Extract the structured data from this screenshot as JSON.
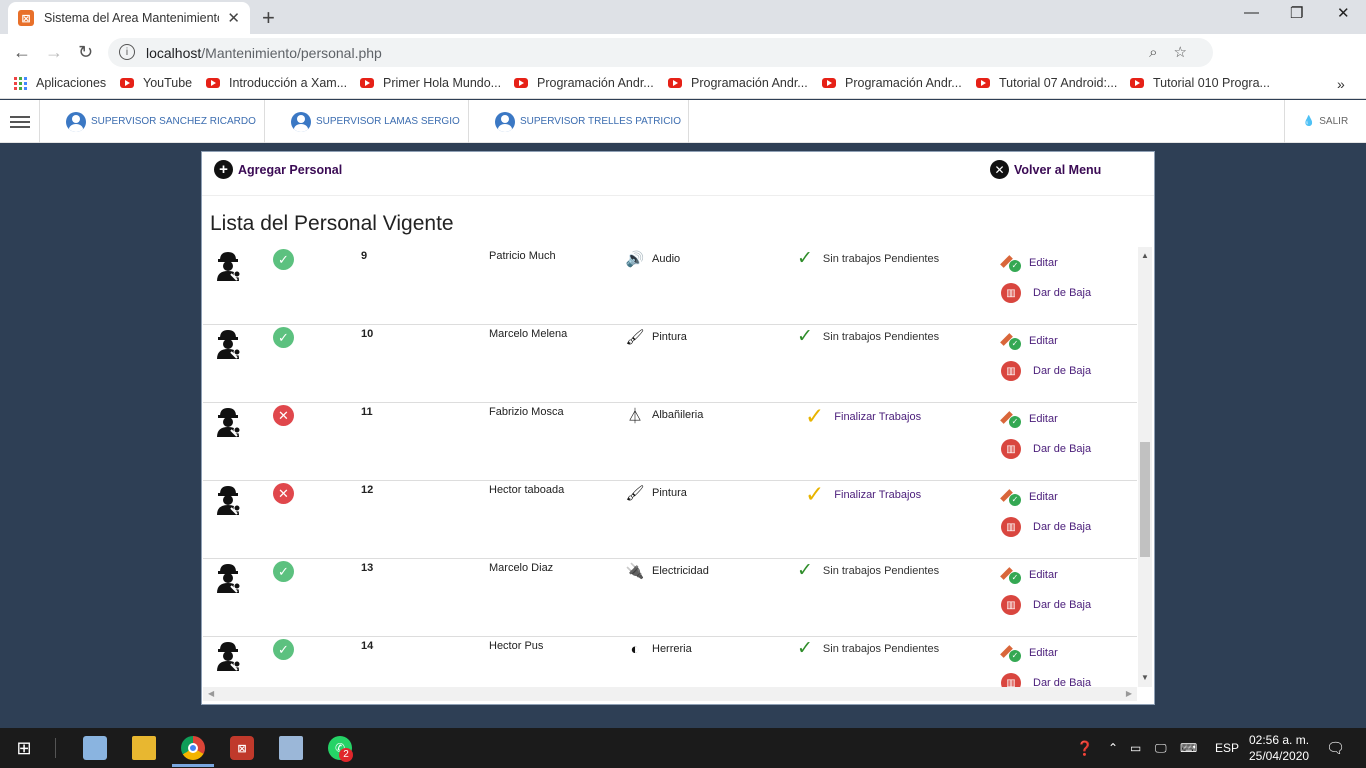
{
  "browser": {
    "tab_title": "Sistema del Area Mantenimiento",
    "url_host": "localhost",
    "url_path": "/Mantenimiento/personal.php"
  },
  "bookmarks": [
    {
      "label": "Aplicaciones",
      "icon": "apps-grid-icon"
    },
    {
      "label": "YouTube",
      "icon": "youtube-icon"
    },
    {
      "label": "Introducción a Xam...",
      "icon": "youtube-icon"
    },
    {
      "label": "Primer Hola Mundo...",
      "icon": "youtube-icon"
    },
    {
      "label": "Programación Andr...",
      "icon": "youtube-icon"
    },
    {
      "label": "Programación Andr...",
      "icon": "youtube-icon"
    },
    {
      "label": "Programación Andr...",
      "icon": "youtube-icon"
    },
    {
      "label": "Tutorial 07 Android:...",
      "icon": "youtube-icon"
    },
    {
      "label": "Tutorial 010 Progra...",
      "icon": "youtube-icon"
    }
  ],
  "nav": {
    "supervisors": [
      "SUPERVISOR SANCHEZ RICARDO",
      "SUPERVISOR LAMAS SERGIO",
      "SUPERVISOR TRELLES PATRICIO"
    ],
    "logout": "SALIR"
  },
  "panel": {
    "add_label": "Agregar Personal",
    "back_label": "Volver al Menu",
    "title": "Lista del Personal Vigente"
  },
  "rows": [
    {
      "status": "ok",
      "id": "9",
      "name": "Patricio Much",
      "specialty": "Audio",
      "specialty_icon": "speaker-icon",
      "work": "Sin trabajos Pendientes",
      "work_type": "done",
      "edit": "Editar",
      "remove": "Dar de Baja"
    },
    {
      "status": "ok",
      "id": "10",
      "name": "Marcelo Melena",
      "specialty": "Pintura",
      "specialty_icon": "paint-gun-icon",
      "work": "Sin trabajos Pendientes",
      "work_type": "done",
      "edit": "Editar",
      "remove": "Dar de Baja"
    },
    {
      "status": "bad",
      "id": "11",
      "name": "Fabrizio Mosca",
      "specialty": "Albañileria",
      "specialty_icon": "trowel-icon",
      "work": "Finalizar Trabajos",
      "work_type": "pending",
      "edit": "Editar",
      "remove": "Dar de Baja"
    },
    {
      "status": "bad",
      "id": "12",
      "name": "Hector taboada",
      "specialty": "Pintura",
      "specialty_icon": "paint-gun-icon",
      "work": "Finalizar Trabajos",
      "work_type": "pending",
      "edit": "Editar",
      "remove": "Dar de Baja"
    },
    {
      "status": "ok",
      "id": "13",
      "name": "Marcelo Diaz",
      "specialty": "Electricidad",
      "specialty_icon": "plug-icon",
      "work": "Sin trabajos Pendientes",
      "work_type": "done",
      "edit": "Editar",
      "remove": "Dar de Baja"
    },
    {
      "status": "ok",
      "id": "14",
      "name": "Hector Pus",
      "specialty": "Herreria",
      "specialty_icon": "welder-icon",
      "work": "Sin trabajos Pendientes",
      "work_type": "done",
      "edit": "Editar",
      "remove": "Dar de Baja"
    }
  ],
  "taskbar": {
    "lang": "ESP",
    "time": "02:56 a. m.",
    "date": "25/04/2020",
    "whatsapp_badge": "2"
  }
}
